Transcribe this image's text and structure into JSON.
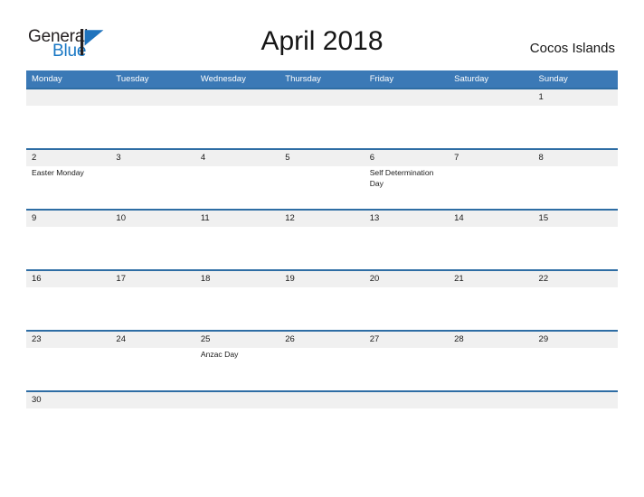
{
  "brand": {
    "name_part1": "General",
    "name_part2": "Blue",
    "flag_icon": "flag-icon",
    "accent_color": "#1877c4",
    "dark_color": "#231f20"
  },
  "header": {
    "title": "April 2018",
    "month": "April",
    "year": "2018",
    "location": "Cocos Islands"
  },
  "theme": {
    "header_blue": "#3b79b6",
    "rule_blue": "#2e6da4",
    "daynum_band": "#f0f0f0",
    "text": "#1a1a1a"
  },
  "calendar": {
    "weekday_headers": [
      "Monday",
      "Tuesday",
      "Wednesday",
      "Thursday",
      "Friday",
      "Saturday",
      "Sunday"
    ],
    "weeks": [
      {
        "days": [
          {
            "num": "",
            "events": []
          },
          {
            "num": "",
            "events": []
          },
          {
            "num": "",
            "events": []
          },
          {
            "num": "",
            "events": []
          },
          {
            "num": "",
            "events": []
          },
          {
            "num": "",
            "events": []
          },
          {
            "num": "1",
            "events": []
          }
        ]
      },
      {
        "days": [
          {
            "num": "2",
            "events": [
              "Easter Monday"
            ]
          },
          {
            "num": "3",
            "events": []
          },
          {
            "num": "4",
            "events": []
          },
          {
            "num": "5",
            "events": []
          },
          {
            "num": "6",
            "events": [
              "Self Determination Day"
            ]
          },
          {
            "num": "7",
            "events": []
          },
          {
            "num": "8",
            "events": []
          }
        ]
      },
      {
        "days": [
          {
            "num": "9",
            "events": []
          },
          {
            "num": "10",
            "events": []
          },
          {
            "num": "11",
            "events": []
          },
          {
            "num": "12",
            "events": []
          },
          {
            "num": "13",
            "events": []
          },
          {
            "num": "14",
            "events": []
          },
          {
            "num": "15",
            "events": []
          }
        ]
      },
      {
        "days": [
          {
            "num": "16",
            "events": []
          },
          {
            "num": "17",
            "events": []
          },
          {
            "num": "18",
            "events": []
          },
          {
            "num": "19",
            "events": []
          },
          {
            "num": "20",
            "events": []
          },
          {
            "num": "21",
            "events": []
          },
          {
            "num": "22",
            "events": []
          }
        ]
      },
      {
        "days": [
          {
            "num": "23",
            "events": []
          },
          {
            "num": "24",
            "events": []
          },
          {
            "num": "25",
            "events": [
              "Anzac Day"
            ]
          },
          {
            "num": "26",
            "events": []
          },
          {
            "num": "27",
            "events": []
          },
          {
            "num": "28",
            "events": []
          },
          {
            "num": "29",
            "events": []
          }
        ]
      },
      {
        "days": [
          {
            "num": "30",
            "events": []
          },
          {
            "num": "",
            "events": []
          },
          {
            "num": "",
            "events": []
          },
          {
            "num": "",
            "events": []
          },
          {
            "num": "",
            "events": []
          },
          {
            "num": "",
            "events": []
          },
          {
            "num": "",
            "events": []
          }
        ]
      }
    ]
  }
}
